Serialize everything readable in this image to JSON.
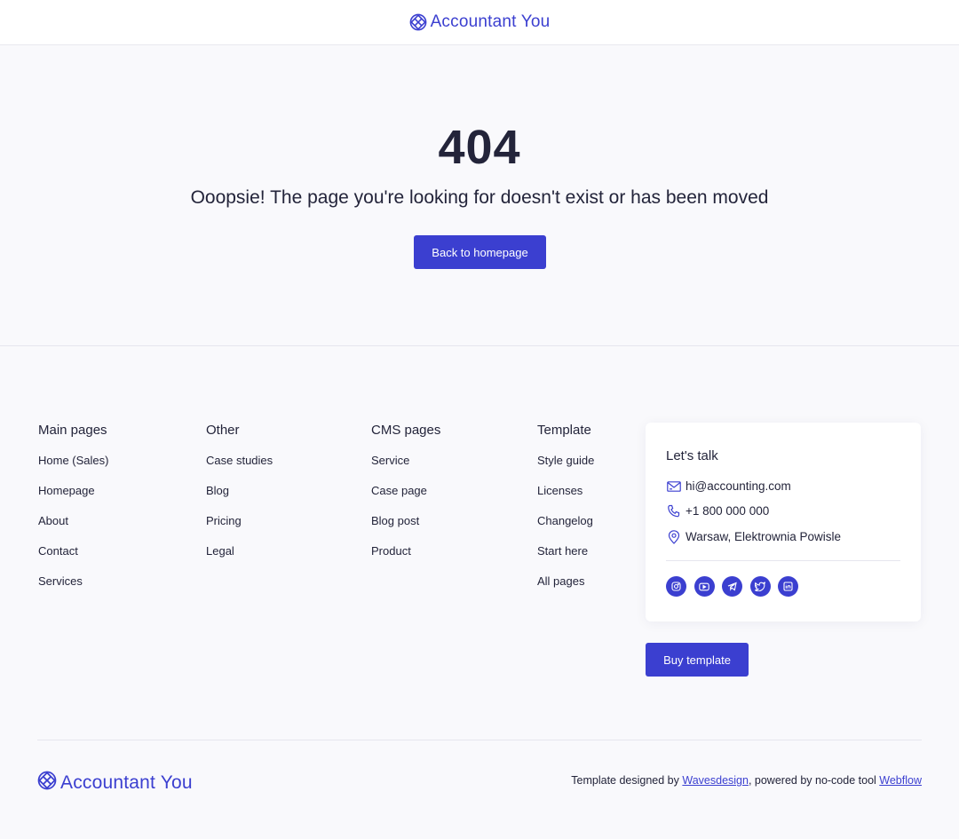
{
  "header": {
    "brand_name": "Accountant You",
    "logo_icon": "diamond-lattice-icon"
  },
  "hero": {
    "error_code": "404",
    "message": "Ooopsie! The page you're looking for doesn't exist or has been moved",
    "button_label": "Back to homepage"
  },
  "footer": {
    "columns": [
      {
        "title": "Main pages",
        "links": [
          "Home (Sales)",
          "Homepage",
          "About",
          "Contact",
          "Services"
        ]
      },
      {
        "title": "Other",
        "links": [
          "Case studies",
          "Blog",
          "Pricing",
          "Legal"
        ]
      },
      {
        "title": "CMS pages",
        "links": [
          "Service",
          "Case page",
          "Blog post",
          "Product"
        ]
      },
      {
        "title": "Template",
        "links": [
          "Style guide",
          "Licenses",
          "Changelog",
          "Start here",
          "All pages"
        ]
      }
    ],
    "contact": {
      "title": "Let's talk",
      "email": "hi@accounting.com",
      "phone": "+1 800 000 000",
      "address": "Warsaw, Elektrownia Powisle",
      "socials": [
        "instagram-icon",
        "youtube-icon",
        "telegram-icon",
        "twitter-icon",
        "linkedin-icon"
      ]
    },
    "buy_button_label": "Buy template",
    "bottom": {
      "brand_name": "Accountant You",
      "credits_prefix": "Template designed by ",
      "credits_link1": "Wavesdesign",
      "credits_middle": ", powered by no-code tool ",
      "credits_link2": "Webflow"
    }
  },
  "colors": {
    "accent": "#3b3fd0",
    "text": "#23243a",
    "background": "#f9f9fc",
    "card": "#ffffff"
  }
}
